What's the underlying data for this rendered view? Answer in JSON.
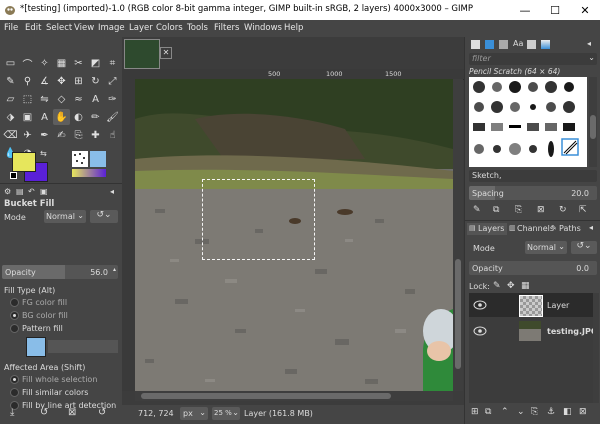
{
  "window": {
    "title": "*[testing] (imported)-1.0 (RGB color 8-bit gamma integer, GIMP built-in sRGB, 2 layers) 4000x3000 – GIMP",
    "minimize": "—",
    "maximize": "☐",
    "close": "✕"
  },
  "menu": [
    "File",
    "Edit",
    "Select",
    "View",
    "Image",
    "Layer",
    "Colors",
    "Tools",
    "Filters",
    "Windows",
    "Help"
  ],
  "colors": {
    "foreground": "#e6e65c",
    "background": "#5a20d8",
    "accent": "#3a8fd8"
  },
  "tool_options": {
    "title": "Bucket Fill",
    "mode_label": "Mode",
    "mode_value": "Normal",
    "opacity_label": "Opacity",
    "opacity_value": "56.0",
    "fill_type_label": "Fill Type  (Alt)",
    "fill_types": [
      "FG color fill",
      "BG color fill",
      "Pattern fill"
    ],
    "fill_type_selected": 1,
    "affected_label": "Affected Area  (Shift)",
    "affected": [
      "Fill whole selection",
      "Fill similar colors",
      "Fill by line art detection"
    ],
    "affected_selected": 0
  },
  "ruler": {
    "marks": [
      "500",
      "1000",
      "1500"
    ]
  },
  "statusbar": {
    "coords": "712, 724",
    "unit": "px",
    "zoom": "25 %",
    "info": "Layer (161.8 MB)"
  },
  "brushes": {
    "filter_placeholder": "filter",
    "name": "Pencil Scratch (64 × 64)",
    "category": "Sketch,",
    "spacing_label": "Spacing",
    "spacing_value": "20.0"
  },
  "layers": {
    "tabs": [
      "Layers",
      "Channels",
      "Paths"
    ],
    "mode_label": "Mode",
    "mode_value": "Normal",
    "opacity_label": "Opacity",
    "opacity_value": "0.0",
    "lock_label": "Lock:",
    "items": [
      {
        "name": "Layer",
        "selected": true
      },
      {
        "name": "testing.JPG",
        "selected": false
      }
    ]
  }
}
